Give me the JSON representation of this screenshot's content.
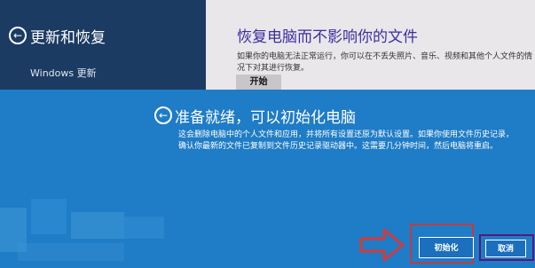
{
  "left_panel": {
    "back_glyph": "←",
    "title": "更新和恢复",
    "item": "Windows 更新"
  },
  "right_panel": {
    "title": "恢复电脑而不影响你的文件",
    "description": "如果你的电脑无法正常运行，你可以在不丢失照片、音乐、视频和其他个人文件的情况下对其进行恢复。",
    "start_button": "开始"
  },
  "dialog": {
    "back_glyph": "←",
    "title": "准备就绪，可以初始化电脑",
    "description": "这会删除电脑中的个人文件和应用，并将所有设置还原为默认设置。如果你使用文件历史记录，确认你最新的文件已复制到文件历史记录驱动器中。这需要几分钟时间，然后电脑将重启。",
    "init_button": "初始化",
    "cancel_button": "取消"
  },
  "colors": {
    "left_bg": "#1b3b63",
    "right_bg": "#e9e7ea",
    "dialog_bg": "#1f7cc6",
    "highlight": "#c33b3e",
    "cancel_outline": "#5b177a"
  }
}
